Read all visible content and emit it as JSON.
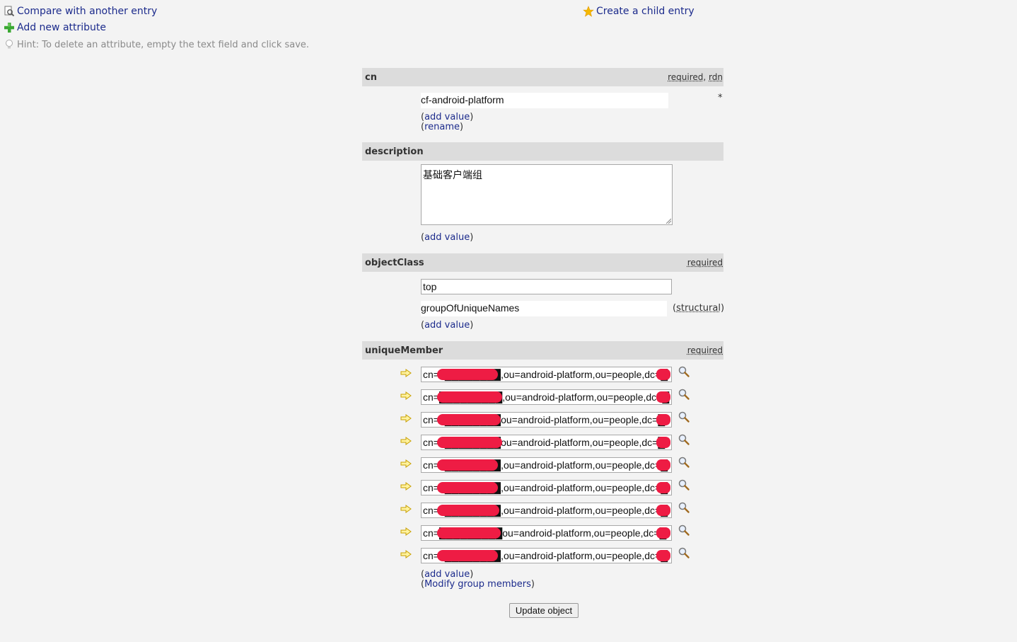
{
  "actions": {
    "compare": "Compare with another entry",
    "add_attribute": "Add new attribute",
    "create_child": "Create a child entry",
    "hint": "Hint: To delete an attribute, empty the text field and click save."
  },
  "attributes": {
    "cn": {
      "name": "cn",
      "tag_required": "required",
      "tag_sep": ", ",
      "tag_rdn": "rdn",
      "value": "cf-android-platform",
      "required_marker": "*",
      "add_value": "add value",
      "rename": "rename"
    },
    "description": {
      "name": "description",
      "value": "基础客户端组",
      "add_value": "add value"
    },
    "objectClass": {
      "name": "objectClass",
      "tag_required": "required",
      "values": [
        "top",
        "groupOfUniqueNames"
      ],
      "structural": "structural",
      "add_value": "add value"
    },
    "uniqueMember": {
      "name": "uniqueMember",
      "tag_required": "required",
      "values": [
        "cn=1████████,ou=android-platform,ou=people,dc=█",
        "cn=█████████,ou=android-platform,ou=people,dc=█",
        "cn=1████████ou=android-platform,ou=people,dc=█",
        "cn=1████████ou=android-platform,ou=people,dc=█",
        "cn=1████████,ou=android-platform,ou=people,dc=█",
        "cn=1████████,ou=android-platform,ou=people,dc=█",
        "cn=1████████,ou=android-platform,ou=people,dc=█",
        "cn=█████████ou=android-platform,ou=people,dc=█",
        "cn=1████████,ou=android-platform,ou=people,dc=█"
      ],
      "add_value": "add value",
      "modify_members": "Modify group members"
    }
  },
  "submit_label": "Update object",
  "colors": {
    "link": "#1c2b8c",
    "header_bg": "#dcdcdc",
    "redaction": "#ee1c44"
  },
  "icons": [
    "compare-icon",
    "add-attribute-icon",
    "star-icon",
    "hint-bulb-icon",
    "arrow-right-icon",
    "magnifier-icon"
  ]
}
